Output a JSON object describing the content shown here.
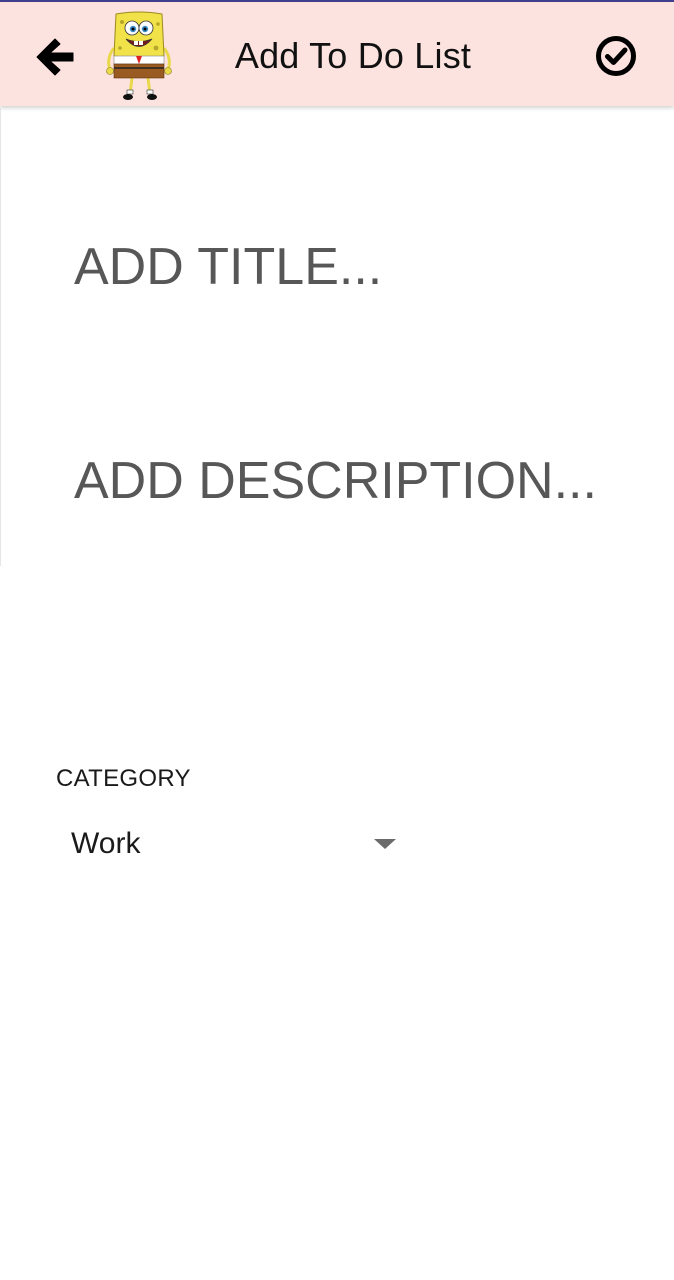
{
  "app_bar": {
    "title": "Add To Do List",
    "back_icon": "arrow-left-icon",
    "confirm_icon": "check-circle-icon",
    "mascot_icon": "spongebob-mascot-icon",
    "background_color": "#fde3e0"
  },
  "form": {
    "title_placeholder": "ADD TITLE...",
    "title_value": "",
    "description_placeholder": "ADD DESCRIPTION...",
    "description_value": ""
  },
  "category": {
    "label": "CATEGORY",
    "selected": "Work",
    "dropdown_icon": "caret-down-icon"
  }
}
